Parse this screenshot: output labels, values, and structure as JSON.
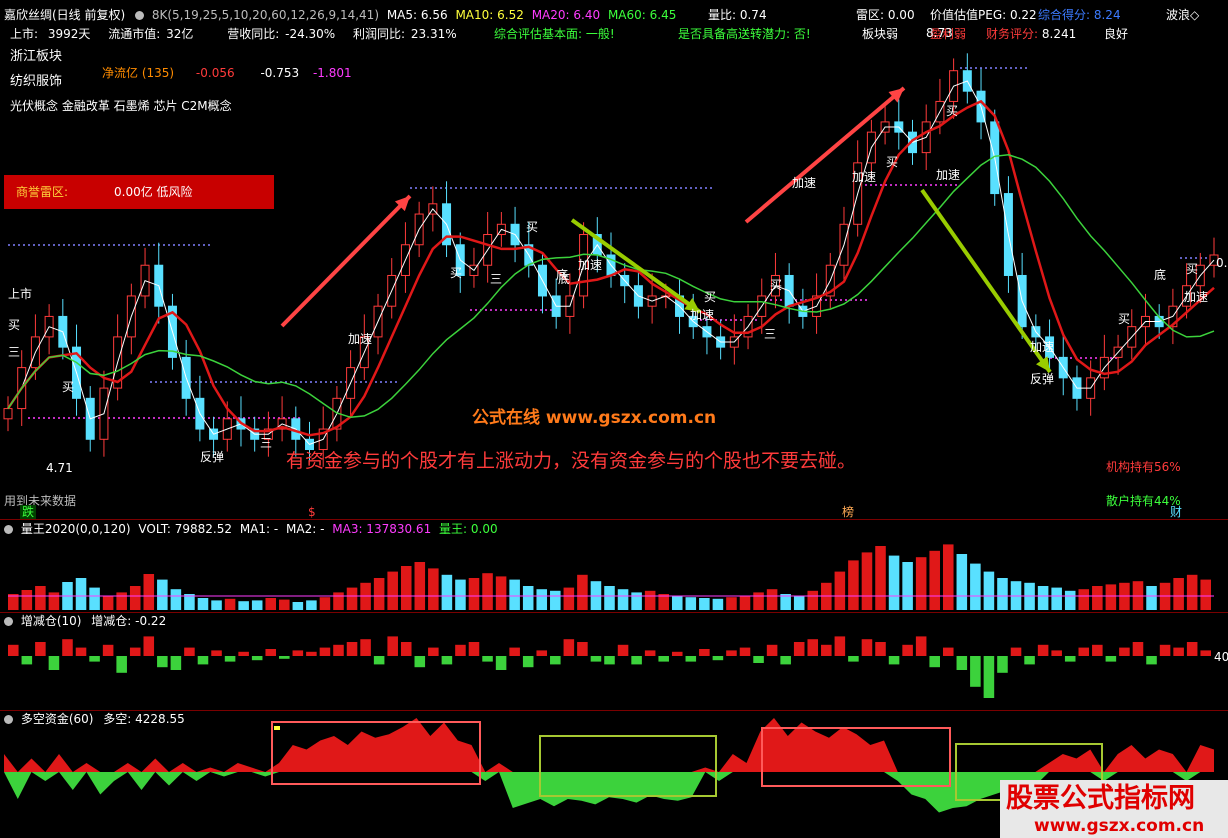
{
  "info_bar": {
    "title": "嘉欣丝绸(日线 前复权)",
    "ma_label": "8K(5,19,25,5,10,20,60,12,26,9,14,41)",
    "ma5": "MA5: 6.56",
    "ma10": "MA10: 6.52",
    "ma20": "MA20: 6.40",
    "ma60": "MA60: 6.45",
    "volume_ratio": "量比: 0.74",
    "thunder": "雷区: 0.00",
    "peg": "价值估值PEG: 0.22",
    "score_label": "综合得分: 8.24",
    "wave_label": "波浪◇"
  },
  "info_row2": {
    "listed": "上市:",
    "listed_val": "3992天",
    "mcap": "流通市值:",
    "mcap_val": "32亿",
    "rev": "营收同比:",
    "rev_val": "-24.30%",
    "profit": "利润同比:",
    "profit_val": "23.31%",
    "eval": "综合评估基本面: 一般!",
    "potential": "是否具备高送转潜力: 否!",
    "sector_weak": "板块弱",
    "profit_weak": "盈利弱",
    "fin_score": "财务评分:",
    "fin_score_val": "8.241",
    "good": "良好"
  },
  "left_tags": {
    "region": "浙江板块",
    "industry": "纺织服饰",
    "concepts": "光伏概念 金融改革 石墨烯 芯片 C2M概念",
    "netflow_label": "净流亿 (135)",
    "netflow_v1": "-0.056",
    "netflow_v2": "-0.753",
    "netflow_v3": "-1.801",
    "risk_label": "商誉雷区:",
    "risk_val": "0.00亿 低风险"
  },
  "annotations": {
    "site": "公式在线 www.gszx.com.cn",
    "message": "有资金参与的个股才有上涨动力，没有资金参与的个股也不要去碰。",
    "future_data": "用到未来数据",
    "inst_hold": "机构持有56%",
    "retail_hold": "散户持有44%",
    "low_price": "4.71",
    "high_price": "8.73",
    "right_val": "0.",
    "marker_die": "跌",
    "marker_dollar": "$",
    "marker_bang": "榜",
    "marker_cai": "财"
  },
  "chart_labels": [
    {
      "text": "上市",
      "color": "#ffffff"
    },
    {
      "text": "买",
      "color": "#ffffff"
    },
    {
      "text": "三",
      "color": "#ffffff"
    },
    {
      "text": "买",
      "color": "#ffffff"
    },
    {
      "text": "反弹",
      "color": "#ffffff"
    },
    {
      "text": "三",
      "color": "#ffffff"
    },
    {
      "text": "加速",
      "color": "#ffffff"
    },
    {
      "text": "买",
      "color": "#ffffff"
    },
    {
      "text": "三",
      "color": "#ffffff"
    },
    {
      "text": "底",
      "color": "#ffffff"
    },
    {
      "text": "买",
      "color": "#ffffff"
    },
    {
      "text": "加速",
      "color": "#ffffff"
    },
    {
      "text": "底",
      "color": "#ffffff"
    },
    {
      "text": "加速",
      "color": "#ffffff"
    },
    {
      "text": "买",
      "color": "#ffffff"
    },
    {
      "text": "三",
      "color": "#ffffff"
    },
    {
      "text": "买",
      "color": "#ffffff"
    },
    {
      "text": "加速",
      "color": "#ffffff"
    },
    {
      "text": "加速",
      "color": "#ffffff"
    },
    {
      "text": "买",
      "color": "#ffffff"
    },
    {
      "text": "加速",
      "color": "#ffffff"
    },
    {
      "text": "买",
      "color": "#ffffff"
    },
    {
      "text": "加速",
      "color": "#ffffff"
    },
    {
      "text": "反弹",
      "color": "#ffffff"
    },
    {
      "text": "买",
      "color": "#ffffff"
    },
    {
      "text": "底",
      "color": "#ffffff"
    },
    {
      "text": "买",
      "color": "#ffffff"
    },
    {
      "text": "加速",
      "color": "#ffffff"
    }
  ],
  "panels": {
    "vol": {
      "name": "量王2020(0,0,120)",
      "volt": "VOLT: 79882.52",
      "ma1": "MA1: -",
      "ma2": "MA2: -",
      "ma3": "MA3: 137830.61",
      "king": "量王: 0.00"
    },
    "pos": {
      "name": "增减仓(10)",
      "val": "增减仓: -0.22",
      "axis": "40"
    },
    "money": {
      "name": "多空资金(60)",
      "val": "多空: 4228.55"
    }
  },
  "watermark": {
    "title": "股票公式指标网",
    "url": "www.gszx.com.cn"
  },
  "chart_data": [
    {
      "type": "candlestick",
      "title": "嘉欣丝绸(日线 前复权)",
      "series": [
        {
          "name": "MA5",
          "value": 6.56
        },
        {
          "name": "MA10",
          "value": 6.52
        },
        {
          "name": "MA20",
          "value": 6.4
        },
        {
          "name": "MA60",
          "value": 6.45
        }
      ],
      "close": [
        5.2,
        5.6,
        5.9,
        6.1,
        5.8,
        5.3,
        4.9,
        5.4,
        5.9,
        6.3,
        6.6,
        6.2,
        5.7,
        5.3,
        5.0,
        4.9,
        5.1,
        5.0,
        4.9,
        5.0,
        5.1,
        4.9,
        4.8,
        5.0,
        5.3,
        5.6,
        5.9,
        6.2,
        6.5,
        6.8,
        7.1,
        7.2,
        6.8,
        6.5,
        6.6,
        6.9,
        7.0,
        6.8,
        6.6,
        6.3,
        6.1,
        6.3,
        6.9,
        6.7,
        6.5,
        6.4,
        6.2,
        6.3,
        6.3,
        6.1,
        6.0,
        5.9,
        5.8,
        5.9,
        6.1,
        6.3,
        6.5,
        6.2,
        6.1,
        6.3,
        6.6,
        7.0,
        7.6,
        7.9,
        8.0,
        7.9,
        7.7,
        8.0,
        8.2,
        8.5,
        8.3,
        8.0,
        7.3,
        6.5,
        6.0,
        5.9,
        5.7,
        5.5,
        5.3,
        5.5,
        5.7,
        5.8,
        6.0,
        6.1,
        6.0,
        6.2,
        6.4,
        6.6,
        6.7
      ],
      "low": 4.71,
      "high": 8.73
    },
    {
      "type": "bar",
      "title": "量王2020(0,0,120)",
      "values": [
        20,
        25,
        30,
        22,
        35,
        40,
        28,
        18,
        22,
        30,
        45,
        38,
        26,
        20,
        15,
        12,
        14,
        11,
        12,
        15,
        13,
        10,
        12,
        16,
        22,
        28,
        34,
        40,
        48,
        55,
        60,
        52,
        44,
        38,
        40,
        46,
        42,
        38,
        30,
        26,
        24,
        28,
        44,
        36,
        30,
        26,
        22,
        24,
        20,
        18,
        16,
        15,
        14,
        16,
        18,
        22,
        26,
        20,
        18,
        24,
        34,
        48,
        62,
        72,
        80,
        68,
        60,
        66,
        74,
        82,
        70,
        58,
        48,
        40,
        36,
        34,
        30,
        28,
        24,
        26,
        30,
        32,
        34,
        36,
        30,
        34,
        40,
        44,
        38
      ]
    },
    {
      "type": "bar",
      "title": "增减仓(10)",
      "values": [
        8,
        -6,
        10,
        -10,
        12,
        6,
        -4,
        8,
        -12,
        6,
        14,
        -8,
        -10,
        6,
        -6,
        4,
        -4,
        3,
        -3,
        5,
        -2,
        4,
        3,
        6,
        8,
        10,
        12,
        -6,
        14,
        10,
        -8,
        6,
        -6,
        8,
        10,
        -4,
        -10,
        6,
        -8,
        4,
        -6,
        12,
        10,
        -4,
        -6,
        8,
        -6,
        4,
        -4,
        3,
        -4,
        5,
        -3,
        4,
        6,
        -5,
        8,
        -6,
        10,
        12,
        8,
        14,
        -4,
        12,
        10,
        -6,
        8,
        14,
        -8,
        6,
        -10,
        -22,
        -30,
        -12,
        6,
        -6,
        8,
        4,
        -4,
        6,
        8,
        -4,
        6,
        10,
        -6,
        8,
        6,
        10,
        4
      ]
    },
    {
      "type": "area",
      "title": "多空资金(60)",
      "values": [
        20,
        -30,
        15,
        -10,
        20,
        -20,
        10,
        -25,
        -10,
        10,
        -20,
        15,
        -15,
        10,
        -10,
        5,
        -5,
        10,
        5,
        -5,
        10,
        30,
        25,
        35,
        40,
        30,
        45,
        38,
        42,
        50,
        60,
        40,
        55,
        35,
        30,
        -10,
        10,
        -40,
        -35,
        -30,
        -38,
        -30,
        -32,
        -36,
        -28,
        -30,
        -34,
        -26,
        -30,
        -32,
        -28,
        5,
        -10,
        20,
        10,
        45,
        60,
        40,
        55,
        45,
        38,
        50,
        42,
        30,
        35,
        -10,
        -25,
        -30,
        -45,
        -40,
        -38,
        -30,
        -25,
        -20,
        -30,
        -15,
        10,
        20,
        15,
        25,
        -10,
        20,
        30,
        15,
        25,
        20,
        -10,
        30,
        25
      ]
    }
  ]
}
